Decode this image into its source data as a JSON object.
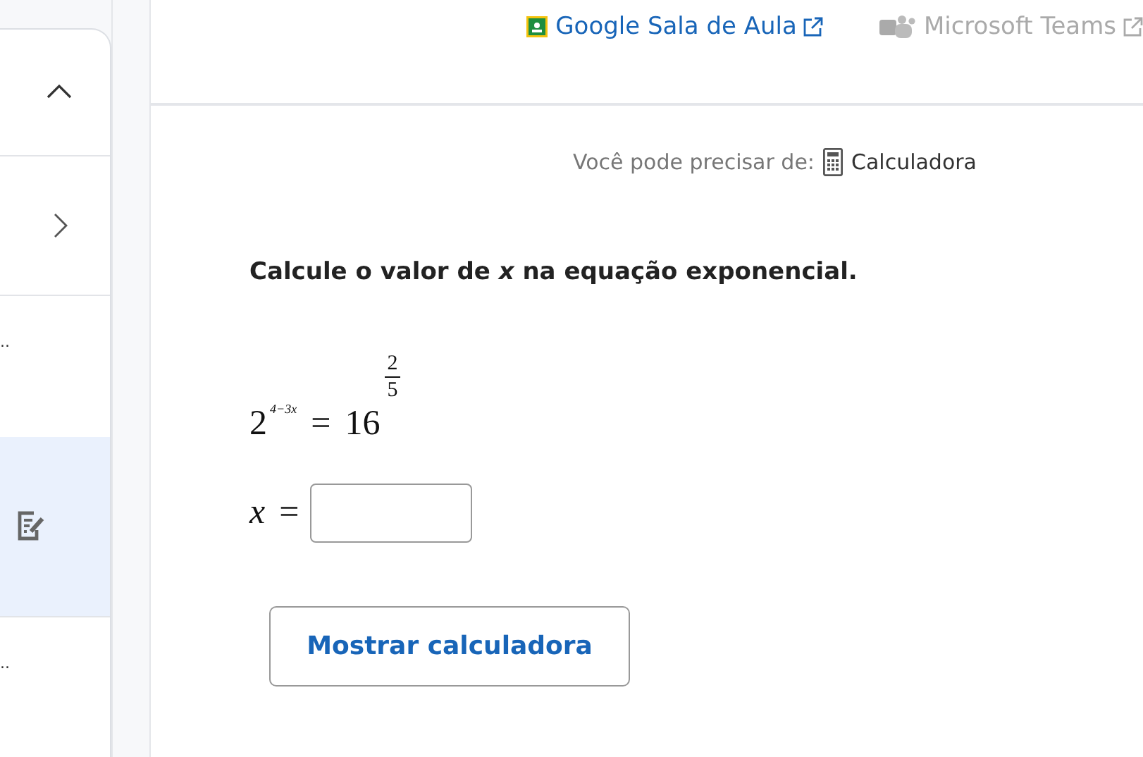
{
  "sidebar": {
    "items": [
      {
        "kind": "collapse",
        "selected": false
      },
      {
        "kind": "expand",
        "selected": false
      },
      {
        "kind": "cut",
        "text": "..",
        "selected": false
      },
      {
        "kind": "exercise",
        "selected": true
      },
      {
        "kind": "cut",
        "text": "..",
        "selected": false
      }
    ]
  },
  "header": {
    "links": [
      {
        "label": "Google Sala de Aula",
        "kind": "classroom",
        "disabled": false
      },
      {
        "label": "Microsoft Teams",
        "kind": "teams",
        "disabled": true
      }
    ]
  },
  "tools": {
    "prefix": "Você pode precisar de:",
    "tool": "Calculadora"
  },
  "question": "Calcule o valor de *x* na equação exponencial.",
  "equation": {
    "base": "2",
    "exponent": "4−3x",
    "equals": "=",
    "rhs_base": "16",
    "numerator": "2",
    "denominator": "5"
  },
  "answer": {
    "variable": "x",
    "equals": "="
  },
  "button": "Mostrar calculadora"
}
